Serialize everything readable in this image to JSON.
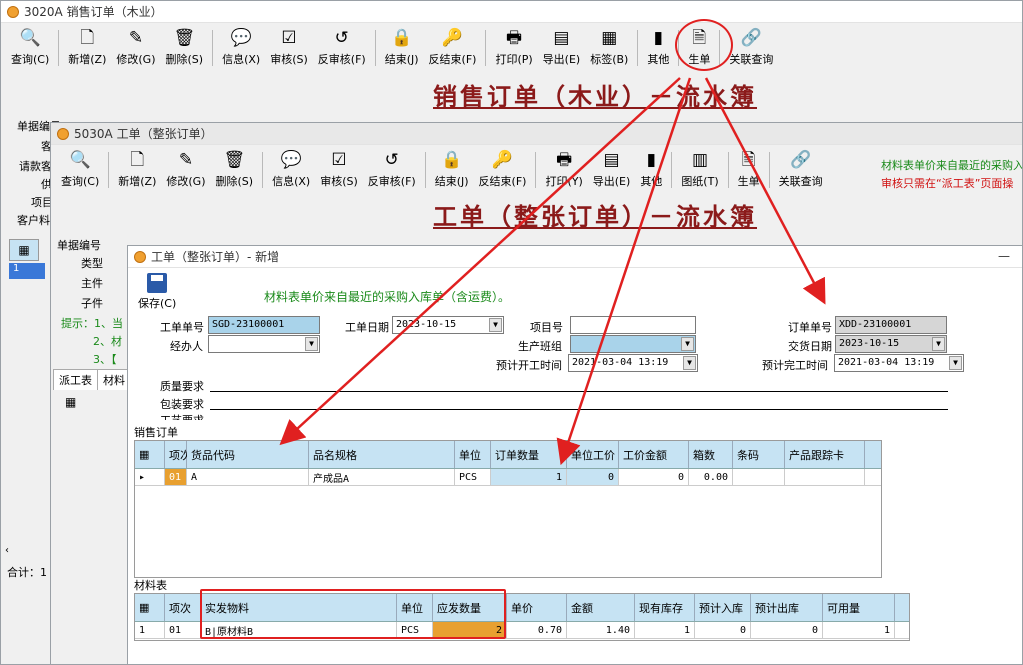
{
  "win1": {
    "title": "3020A 销售订单（木业）",
    "toolbar": [
      "查询(C)",
      "新增(Z)",
      "修改(G)",
      "删除(S)",
      "信息(X)",
      "审核(S)",
      "反审核(F)",
      "结束(J)",
      "反结束(F)",
      "打印(P)",
      "导出(E)",
      "标签(B)",
      "其他",
      "生单",
      "关联查询"
    ],
    "heading": "销售订单（木业）－流水簿",
    "labels": [
      "单据编号",
      "客",
      "请款客",
      "供",
      "项目",
      "客户料"
    ],
    "grid_row_num": "1",
    "footer_left": "合计：1"
  },
  "win2": {
    "title": "5030A 工单（整张订单）",
    "toolbar": [
      "查询(C)",
      "新增(Z)",
      "修改(G)",
      "删除(S)",
      "信息(X)",
      "审核(S)",
      "反审核(F)",
      "结束(J)",
      "反结束(F)",
      "打印(Y)",
      "导出(E)",
      "其他",
      "图纸(T)",
      "生单",
      "关联查询"
    ],
    "notes": [
      "材料表单价来自最近的采购入",
      "审核只需在“派工表”页面操"
    ],
    "heading": "工单（整张订单）－流水簿",
    "labels": [
      "单据编号",
      "类型",
      "主件",
      "子件"
    ],
    "tip_lines": [
      "提示：1、当",
      "2、材",
      "3、【"
    ],
    "tabs": [
      "派工表",
      "材料"
    ]
  },
  "win3": {
    "title": "工单（整张订单）- 新增",
    "save_label": "保存(C)",
    "note": "材料表单价来自最近的采购入库单（含运费）。",
    "fields": {
      "order_no_label": "工单单号",
      "order_no": "SGD-23100001",
      "date_label": "工单日期",
      "date": "2023-10-15",
      "project_label": "项目号",
      "handler_label": "经办人",
      "team_label": "生产班组",
      "plan_start_label": "预计开工时间",
      "plan_start": "2021-03-04 13:19",
      "sales_no_label": "订单单号",
      "sales_no": "XDD-23100001",
      "delivery_label": "交货日期",
      "delivery": "2023-10-15",
      "plan_end_label": "预计完工时间",
      "plan_end": "2021-03-04 13:19",
      "quality_label": "质量要求",
      "pack_label": "包装要求",
      "process_label": "工艺要求"
    },
    "sales_section": "销售订单",
    "sales_headers": [
      "项次",
      "货品代码",
      "品名规格",
      "单位",
      "订单数量",
      "单位工价",
      "工价金额",
      "箱数",
      "条码",
      "产品跟踪卡"
    ],
    "sales_rows": [
      [
        "01",
        "A",
        "产成品A",
        "PCS",
        "1",
        "0",
        "0",
        "0.00",
        "",
        ""
      ]
    ],
    "material_section": "材料表",
    "material_headers": [
      "项次",
      "实发物料",
      "单位",
      "应发数量",
      "单价",
      "金额",
      "现有库存",
      "预计入库",
      "预计出库",
      "可用量"
    ],
    "material_rows": [
      [
        "1",
        "01",
        "B|原材料B",
        "PCS",
        "2",
        "0.70",
        "1.40",
        "1",
        "0",
        "0",
        "1"
      ]
    ],
    "minimize": "—"
  },
  "colors": {
    "accent_red": "#e02020",
    "title_red": "#8b1a1a",
    "grid_header": "#c6e3f3",
    "highlight_orange": "#e8a030"
  }
}
